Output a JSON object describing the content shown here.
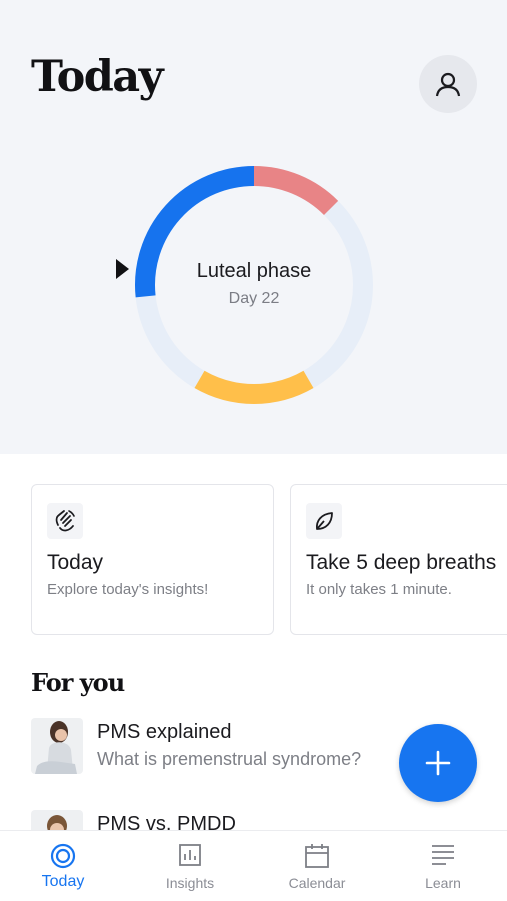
{
  "header": {
    "title": "Today",
    "profile_icon": "person-icon"
  },
  "cycle": {
    "phase_name": "Luteal phase",
    "day_label": "Day 22",
    "colors": {
      "track": "#e7eef8",
      "blue": "#1673ee",
      "red": "#e88486",
      "yellow": "#ffbf4a"
    }
  },
  "cards": [
    {
      "icon": "waving-hand-icon",
      "title": "Today",
      "subtitle": "Explore today's insights!"
    },
    {
      "icon": "leaf-icon",
      "title": "Take 5 deep breaths",
      "subtitle": "It only takes 1 minute."
    }
  ],
  "for_you": {
    "title": "For you",
    "articles": [
      {
        "title": "PMS explained",
        "subtitle": "What is premenstrual syndrome?"
      },
      {
        "title": "PMS vs. PMDD",
        "subtitle": ""
      }
    ]
  },
  "fab": {
    "icon": "plus-icon",
    "color": "#1775f0"
  },
  "tabbar": {
    "tabs": [
      {
        "label": "Today",
        "icon": "ring-icon",
        "active": true
      },
      {
        "label": "Insights",
        "icon": "chart-icon",
        "active": false
      },
      {
        "label": "Calendar",
        "icon": "calendar-icon",
        "active": false
      },
      {
        "label": "Learn",
        "icon": "lines-icon",
        "active": false
      }
    ]
  }
}
